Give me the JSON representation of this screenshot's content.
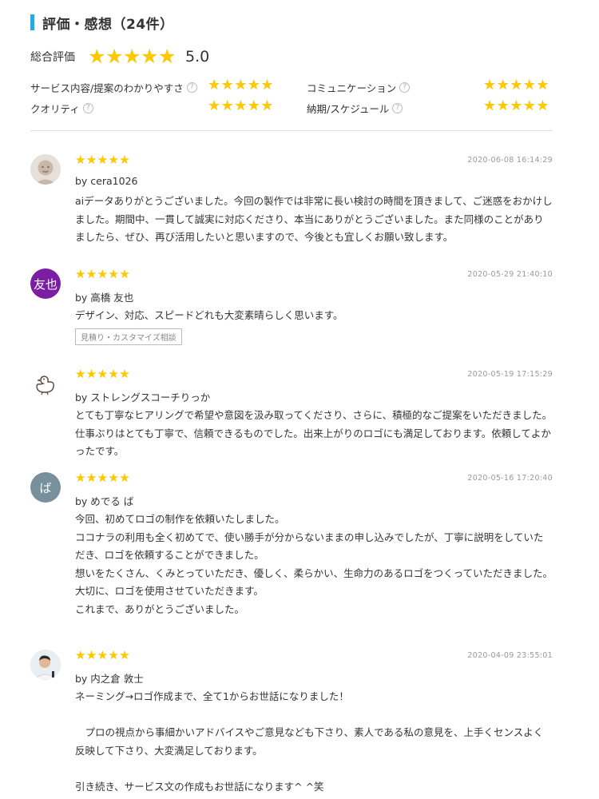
{
  "section": {
    "title": "評価・感想（24件）"
  },
  "overall": {
    "label": "総合評価",
    "score": "5.0",
    "rating": 5
  },
  "sub_ratings": [
    {
      "label": "サービス内容/提案のわかりやすさ",
      "rating": 4.8
    },
    {
      "label": "コミュニケーション",
      "rating": 5.0
    },
    {
      "label": "クオリティ",
      "rating": 4.8
    },
    {
      "label": "納期/スケジュール",
      "rating": 4.8
    }
  ],
  "help_icon": "question-circle-icon",
  "colors": {
    "accent": "#2ea7e0",
    "star": "#ffc900",
    "star_empty": "#d0d0d0"
  },
  "reviews": [
    {
      "avatar": "person-silhouette",
      "avatar_text": "",
      "rating": 5,
      "date": "2020-06-08 16:14:29",
      "by": "by cera1026",
      "body": "aiデータありがとうございました。今回の製作では非常に長い検討の時間を頂きまして、ご迷惑をおかけしました。期間中、一貫して誠実に対応くださり、本当にありがとうございました。また同様のことがありましたら、ぜひ、再び活用したいと思いますので、今後とも宜しくお願い致します。"
    },
    {
      "avatar": "initials",
      "avatar_text": "友也",
      "avatar_color": "#7b1fa2",
      "rating": 5,
      "date": "2020-05-29 21:40:10",
      "by": "by 高橋 友也",
      "body": "デザイン、対応、スピードどれも大変素晴らしく思います。",
      "tag": "見積り・カスタマイズ相談"
    },
    {
      "avatar": "duck-drawing",
      "avatar_text": "",
      "rating": 5,
      "date": "2020-05-19 17:15:29",
      "by": "by ストレングスコーチりっか",
      "body": "とても丁寧なヒアリングで希望や意図を汲み取ってくださり、さらに、積極的なご提案をいただきました。仕事ぶりはとても丁寧で、信頼できるものでした。出来上がりのロゴにも満足しております。依頼してよかったです。"
    },
    {
      "avatar": "initials",
      "avatar_text": "ば",
      "avatar_color": "#78909c",
      "rating": 5,
      "date": "2020-05-16 17:20:40",
      "by": "by めでる ば",
      "body": "今回、初めてロゴの制作を依頼いたしました。\nココナラの利用も全く初めてで、使い勝手が分からないままの申し込みでしたが、丁寧に説明をしていただき、ロゴを依頼することができました。\n想いをたくさん、くみとっていただき、優しく、柔らかい、生命力のあるロゴをつくっていただきました。\n大切に、ロゴを使用させていただきます。\nこれまで、ありがとうございました。"
    },
    {
      "avatar": "photo-person",
      "avatar_text": "",
      "rating": 5,
      "date": "2020-04-09 23:55:01",
      "by": "by 内之倉 敦士",
      "body": "ネーミング→ロゴ作成まで、全て1からお世話になりました！\n\n　プロの視点から事細かいアドバイスやご意見なども下さり、素人である私の意見を、上手くセンスよく反映して下さり、大変満足しております。\n\n引き続き、サービス文の作成もお世話になります^ ^笑"
    }
  ]
}
